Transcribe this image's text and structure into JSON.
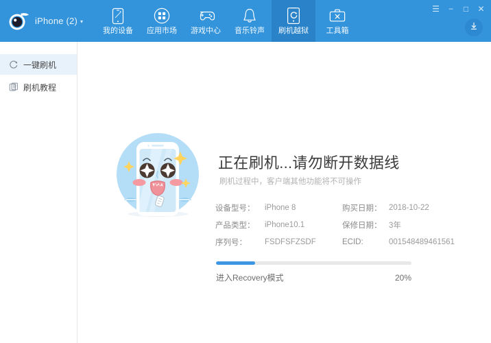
{
  "header": {
    "brand_label": "iPhone (2)",
    "brand_caret": "▾",
    "logo_icon": "comet-eye-logo",
    "nav": [
      {
        "label": "我的设备",
        "icon": "phone-icon"
      },
      {
        "label": "应用市场",
        "icon": "grid-apps-icon"
      },
      {
        "label": "游戏中心",
        "icon": "gamepad-icon"
      },
      {
        "label": "音乐铃声",
        "icon": "bell-icon"
      },
      {
        "label": "刷机越狱",
        "icon": "flash-device-icon"
      },
      {
        "label": "工具箱",
        "icon": "toolbox-icon"
      }
    ],
    "active_nav_index": 4,
    "window_controls": [
      {
        "name": "menu",
        "glyph": "☰"
      },
      {
        "name": "minimize",
        "glyph": "−"
      },
      {
        "name": "maximize",
        "glyph": "□"
      },
      {
        "name": "close",
        "glyph": "✕"
      }
    ],
    "download_icon": "download-icon"
  },
  "sidebar": {
    "items": [
      {
        "label": "一键刷机",
        "icon": "refresh-circle-icon",
        "active": true
      },
      {
        "label": "刷机教程",
        "icon": "document-icon",
        "active": false
      }
    ]
  },
  "main": {
    "illustration": "phone-mascot-illustration",
    "title": "正在刷机...请勿断开数据线",
    "subtitle": "刷机过程中，客户端其他功能将不可操作",
    "info_rows": [
      {
        "left_label": "设备型号：",
        "left_value": "iPhone 8",
        "right_label": "购买日期：",
        "right_value": "2018-10-22"
      },
      {
        "left_label": "产品类型：",
        "left_value": "iPhone10.1",
        "right_label": "保修日期：",
        "right_value": "3年"
      },
      {
        "left_label": "序列号：",
        "left_value": "FSDFSFZSDF",
        "right_label": "ECID:",
        "right_value": "001548489461561"
      }
    ],
    "progress": {
      "label": "进入Recovery模式",
      "percent_text": "20%",
      "percent_value": 20
    }
  },
  "colors": {
    "header_blue": "#3394db",
    "active_tab_blue": "#2a83c8",
    "progress_blue": "#3d97e2",
    "sidebar_active": "#e8f2fb"
  }
}
